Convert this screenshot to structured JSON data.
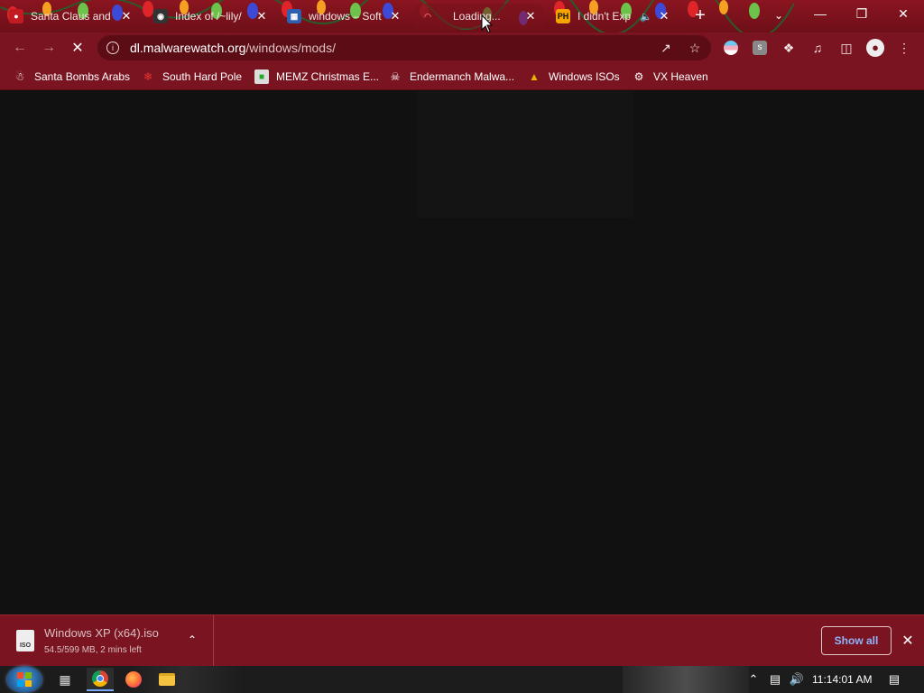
{
  "window": {
    "minimize_icon": "minimize-icon",
    "restore_icon": "restore-icon",
    "close_icon": "close-icon"
  },
  "tabs": [
    {
      "title": "Santa Claus and",
      "favicon": "santa-icon",
      "active": false
    },
    {
      "title": "Index of /~lily/",
      "favicon": "index-icon",
      "active": false
    },
    {
      "title": "windows – Soft",
      "favicon": "software-icon",
      "active": false
    },
    {
      "title": "Loading...",
      "favicon": "loading-spinner-icon",
      "active": true
    },
    {
      "title": "I didn't Exp",
      "favicon": "ph-icon",
      "favicon_text": "PH",
      "audio_icon": "speaker-icon",
      "active": false
    }
  ],
  "toolbar": {
    "back_icon": "arrow-left-icon",
    "forward_icon": "arrow-right-icon",
    "reload_icon": "stop-icon",
    "url_host": "dl.malwarewatch.org",
    "url_path": "/windows/mods/"
  },
  "bookmarks": [
    {
      "label": "Santa Bombs Arabs",
      "icon": "santa-icon"
    },
    {
      "label": "South Hard Pole",
      "icon": "snowflake-icon"
    },
    {
      "label": "MEMZ Christmas E...",
      "icon": "memz-icon"
    },
    {
      "label": "Endermanch Malwa...",
      "icon": "skull-icon"
    },
    {
      "label": "Windows ISOs",
      "icon": "trophy-icon"
    },
    {
      "label": "VX Heaven",
      "icon": "vx-icon"
    }
  ],
  "download": {
    "filename": "Windows XP (x64).iso",
    "status": "54.5/599 MB, 2 mins left",
    "icon_text": "ISO",
    "show_all_label": "Show all"
  },
  "taskbar": {
    "clock": "11:14:01 AM"
  },
  "colors": {
    "chrome_red": "#7a1420",
    "tabstrip_red": "#8a1520",
    "content_bg": "#111112",
    "taskbar_bg": "#1c1c1c",
    "link_blue": "#8eb4ff"
  }
}
